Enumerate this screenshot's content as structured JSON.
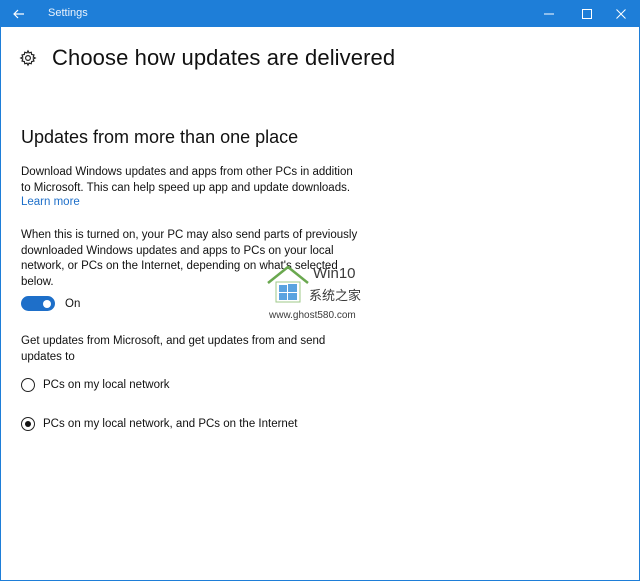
{
  "window": {
    "title": "Settings",
    "accent": "#1e7ed8",
    "link_color": "#1e6fc9"
  },
  "page": {
    "title": "Choose how updates are delivered",
    "icon": "gear-icon"
  },
  "section": {
    "title": "Updates from more than one place",
    "description_line1": "Download Windows updates and apps from other PCs in addition",
    "description_line2": "to Microsoft. This can help speed up app and update downloads.",
    "learn_more": "Learn more",
    "info_line1": "When this is turned on, your PC may also send parts of previously",
    "info_line2": "downloaded Windows updates and apps to PCs on your local",
    "info_line3": "network, or PCs on the Internet, depending on what's selected",
    "info_line4": "below.",
    "toggle_state": "On",
    "source_line1": "Get updates from Microsoft, and get updates from and send",
    "source_line2": "updates to",
    "options": [
      {
        "label": "PCs on my local network",
        "selected": false
      },
      {
        "label": "PCs on my local network, and PCs on the Internet",
        "selected": true
      }
    ]
  },
  "watermark": {
    "title": "Win10",
    "subtitle": "系统之家",
    "url": "www.ghost580.com"
  }
}
